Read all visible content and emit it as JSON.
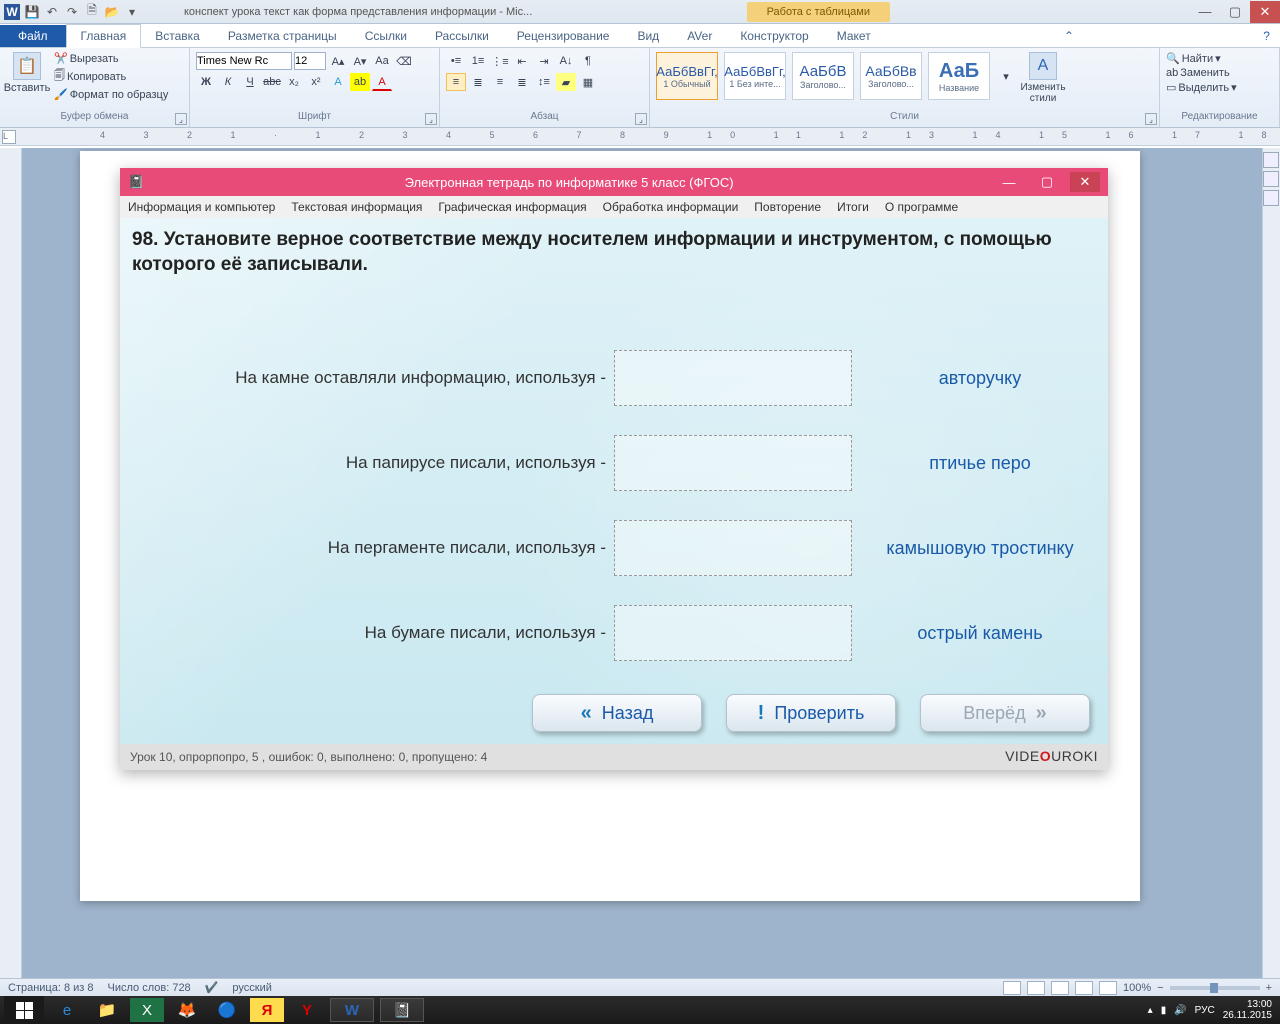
{
  "titlebar": {
    "doc_title": "конспект урока текст как форма представления информации - Mic...",
    "context_tab": "Работа с таблицами"
  },
  "ribbon_tabs": {
    "file": "Файл",
    "items": [
      "Главная",
      "Вставка",
      "Разметка страницы",
      "Ссылки",
      "Рассылки",
      "Рецензирование",
      "Вид",
      "AVer",
      "Конструктор",
      "Макет"
    ],
    "active_index": 0
  },
  "ribbon": {
    "clipboard": {
      "paste": "Вставить",
      "cut": "Вырезать",
      "copy": "Копировать",
      "format_painter": "Формат по образцу",
      "label": "Буфер обмена"
    },
    "font": {
      "name": "Times New Rc",
      "size": "12",
      "label": "Шрифт"
    },
    "paragraph": {
      "label": "Абзац"
    },
    "styles": {
      "label": "Стили",
      "items": [
        {
          "sample": "АаБбВвГг,",
          "name": "1 Обычный"
        },
        {
          "sample": "АаБбВвГг,",
          "name": "1 Без инте..."
        },
        {
          "sample": "АаБбВ",
          "name": "Заголово..."
        },
        {
          "sample": "АаБбВв",
          "name": "Заголово..."
        },
        {
          "sample": "АаБ",
          "name": "Название"
        }
      ],
      "change": "Изменить стили"
    },
    "editing": {
      "find": "Найти",
      "replace": "Заменить",
      "select": "Выделить",
      "label": "Редактирование"
    }
  },
  "app": {
    "title": "Электронная тетрадь по информатике 5 класс (ФГОС)",
    "menu": [
      "Информация и компьютер",
      "Текстовая информация",
      "Графическая информация",
      "Обработка информации",
      "Повторение",
      "Итоги",
      "О программе"
    ],
    "question": "98. Установите верное соответствие между носителем информации и инструментом, с помощью которого её записывали.",
    "rows": [
      {
        "prompt": "На камне оставляли информацию, используя -",
        "answer": "авторучку"
      },
      {
        "prompt": "На папирусе писали, используя -",
        "answer": "птичье перо"
      },
      {
        "prompt": "На пергаменте писали, используя -",
        "answer": "камышовую тростинку"
      },
      {
        "prompt": "На бумаге писали, используя -",
        "answer": "острый камень"
      }
    ],
    "buttons": {
      "back": "Назад",
      "check": "Проверить",
      "next": "Вперёд"
    },
    "status": "Урок 10, опрорпопро, 5 , ошибок: 0, выполнено: 0, пропущено: 4",
    "brand_pre": "VIDE",
    "brand_o": "O",
    "brand_post": "UROKI"
  },
  "statusbar": {
    "page": "Страница: 8 из 8",
    "words": "Число слов: 728",
    "lang": "русский",
    "zoom": "100%"
  },
  "tray": {
    "lang": "РУС",
    "time": "13:00",
    "date": "26.11.2015"
  }
}
